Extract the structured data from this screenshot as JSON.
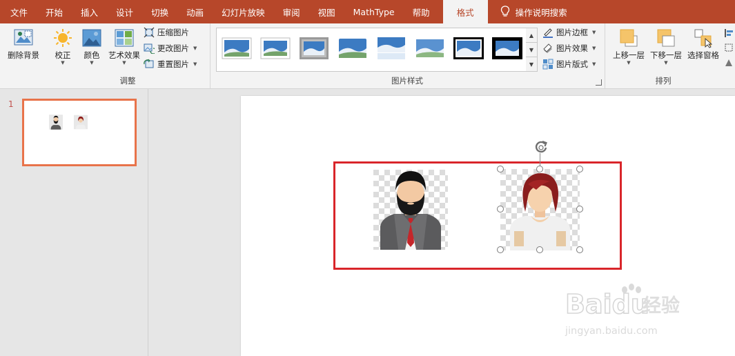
{
  "tabs": [
    {
      "label": "文件",
      "active": false
    },
    {
      "label": "开始",
      "active": false
    },
    {
      "label": "插入",
      "active": false
    },
    {
      "label": "设计",
      "active": false
    },
    {
      "label": "切换",
      "active": false
    },
    {
      "label": "动画",
      "active": false
    },
    {
      "label": "幻灯片放映",
      "active": false
    },
    {
      "label": "审阅",
      "active": false
    },
    {
      "label": "视图",
      "active": false
    },
    {
      "label": "MathType",
      "active": false
    },
    {
      "label": "帮助",
      "active": false
    },
    {
      "label": "格式",
      "active": true
    }
  ],
  "tell_me": "操作说明搜索",
  "ribbon": {
    "remove_bg": "删除背景",
    "adjust": {
      "corrections": "校正",
      "color": "颜色",
      "artistic": "艺术效果",
      "compress": "压缩图片",
      "change": "更改图片",
      "reset": "重置图片",
      "group_label": "调整"
    },
    "styles": {
      "border": "图片边框",
      "effects": "图片效果",
      "layout": "图片版式",
      "group_label": "图片样式"
    },
    "arrange": {
      "bring_forward": "上移一层",
      "send_backward": "下移一层",
      "selection_pane": "选择窗格",
      "group_label": "排列"
    }
  },
  "slide_number": "1",
  "watermark": {
    "brand": "Baidu",
    "cn": "经验",
    "url": "jingyan.baidu.com"
  },
  "colors": {
    "accent": "#b7472a",
    "highlight": "#d9252a",
    "thumb_border": "#e8734a"
  }
}
